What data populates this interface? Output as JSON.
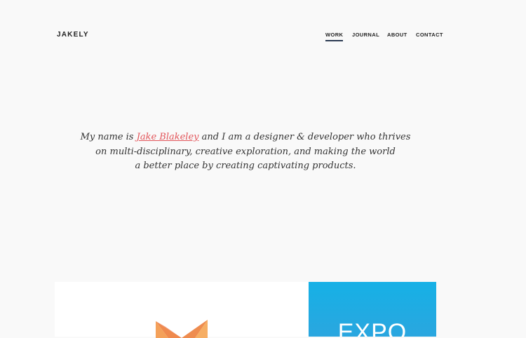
{
  "header": {
    "logo": "JAKELY",
    "nav": [
      {
        "label": "WORK",
        "active": true
      },
      {
        "label": "JOURNAL",
        "active": false
      },
      {
        "label": "ABOUT",
        "active": false
      },
      {
        "label": "CONTACT",
        "active": false
      }
    ]
  },
  "intro": {
    "before_link": "My name is ",
    "link": "Jake Blakeley",
    "after_link": " and I am a designer & developer who thrives",
    "line2": "on multi-disciplinary, creative exploration, and making the world",
    "line3": "a better place by creating captivating products."
  },
  "portfolio": {
    "cards": [
      {
        "logo_icon": "m-logo-icon",
        "background": "#ffffff"
      },
      {
        "title": "EXPO",
        "background": "#16b1e6"
      }
    ]
  },
  "colors": {
    "link": "#e2555a",
    "nav_underline": "#2b3a52",
    "page_background": "#f9f9f9"
  }
}
